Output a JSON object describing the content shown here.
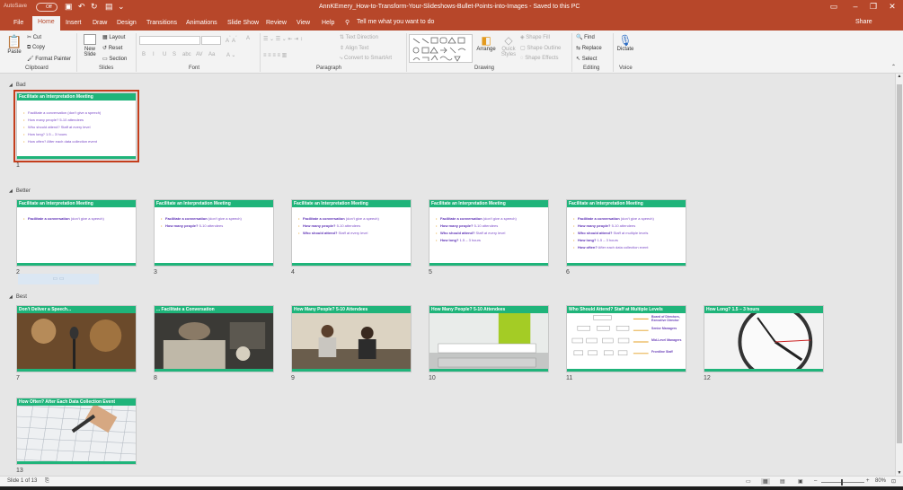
{
  "titlebar": {
    "autosave_label": "AutoSave",
    "autosave_state": "Off",
    "document_title": "AnnKEmery_How-to-Transform-Your-Slideshows-Bullet-Points-into-Images  -  Saved to this PC"
  },
  "tabs": [
    "File",
    "Home",
    "Insert",
    "Draw",
    "Design",
    "Transitions",
    "Animations",
    "Slide Show",
    "Review",
    "View",
    "Help"
  ],
  "active_tab": "Home",
  "tell_me": "Tell me what you want to do",
  "share": "Share",
  "ribbon": {
    "clipboard": {
      "paste": "Paste",
      "cut": "Cut",
      "copy": "Copy",
      "format_painter": "Format Painter",
      "label": "Clipboard"
    },
    "slides": {
      "new_slide": "New Slide",
      "layout": "Layout",
      "reset": "Reset",
      "section": "Section",
      "label": "Slides"
    },
    "font": {
      "label": "Font",
      "format_buttons": [
        "B",
        "I",
        "U",
        "S",
        "abc",
        "AV",
        "Aa"
      ]
    },
    "paragraph": {
      "text_direction": "Text Direction",
      "align_text": "Align Text",
      "convert_smartart": "Convert to SmartArt",
      "label": "Paragraph"
    },
    "drawing": {
      "arrange": "Arrange",
      "quick_styles": "Quick Styles",
      "shape_fill": "Shape Fill",
      "shape_outline": "Shape Outline",
      "shape_effects": "Shape Effects",
      "label": "Drawing"
    },
    "editing": {
      "find": "Find",
      "replace": "Replace",
      "select": "Select",
      "label": "Editing"
    },
    "voice": {
      "dictate": "Dictate",
      "label": "Voice"
    }
  },
  "sections": [
    {
      "name": "Bad"
    },
    {
      "name": "Better"
    },
    {
      "name": "Best"
    }
  ],
  "slides": [
    {
      "num": "1",
      "title": "Facilitate an Interpretation Meeting",
      "bullets": [
        [
          "",
          "Facilitate a conversation (don't give a speech)"
        ],
        [
          "",
          "How many people? 5-10 attendees"
        ],
        [
          "",
          "Who should attend? Staff at every level"
        ],
        [
          "",
          "How long? 1.5 – 3 hours"
        ],
        [
          "",
          "How often? After each data collection event"
        ]
      ],
      "kind": "text"
    },
    {
      "num": "2",
      "title": "Facilitate an Interpretation Meeting",
      "bullets": [
        [
          "Facilitate a conversation",
          " (don't give a speech)"
        ]
      ],
      "kind": "text"
    },
    {
      "num": "3",
      "title": "Facilitate an Interpretation Meeting",
      "bullets": [
        [
          "Facilitate a conversation",
          " (don't give a speech)"
        ],
        [
          "How many people?",
          " 5-10 attendees"
        ]
      ],
      "kind": "text"
    },
    {
      "num": "4",
      "title": "Facilitate an Interpretation Meeting",
      "bullets": [
        [
          "Facilitate a conversation",
          " (don't give a speech)"
        ],
        [
          "How many people?",
          " 5-10 attendees"
        ],
        [
          "Who should attend?",
          " Staff at every level"
        ]
      ],
      "kind": "text"
    },
    {
      "num": "5",
      "title": "Facilitate an Interpretation Meeting",
      "bullets": [
        [
          "Facilitate a conversation",
          " (don't give a speech)"
        ],
        [
          "How many people?",
          " 5-10 attendees"
        ],
        [
          "Who should attend?",
          " Staff at every level"
        ],
        [
          "How long?",
          " 1.5 – 3 hours"
        ]
      ],
      "kind": "text"
    },
    {
      "num": "6",
      "title": "Facilitate an Interpretation Meeting",
      "bullets": [
        [
          "Facilitate a conversation",
          " (don't give a speech)"
        ],
        [
          "How many people?",
          " 5-10 attendees"
        ],
        [
          "Who should attend?",
          " Staff at multiple levels"
        ],
        [
          "How long?",
          " 1.5 – 3 hours"
        ],
        [
          "How often?",
          " After each data collection event"
        ]
      ],
      "kind": "text"
    },
    {
      "num": "7",
      "title": "Don't Deliver a Speech...",
      "kind": "photo",
      "photo": "microphone"
    },
    {
      "num": "8",
      "title": "... Facilitate a Conversation",
      "kind": "photo",
      "photo": "meeting"
    },
    {
      "num": "9",
      "title": "How Many People? 5-10 Attendees",
      "kind": "photo",
      "photo": "people"
    },
    {
      "num": "10",
      "title": "How Many People? 5-10 Attendees",
      "kind": "photo",
      "photo": "room"
    },
    {
      "num": "11",
      "title": "Who Should Attend? Staff at Multiple Levels",
      "kind": "diagram",
      "labels": [
        "Board of Directors, Executive Director",
        "Senior Managers",
        "Mid-Level Managers",
        "Frontline Staff"
      ]
    },
    {
      "num": "12",
      "title": "How Long? 1.5 – 3 hours",
      "kind": "photo",
      "photo": "clock"
    },
    {
      "num": "13",
      "title": "How Often? After Each Data Collection Event",
      "kind": "photo",
      "photo": "calendar"
    }
  ],
  "statusbar": {
    "slide_info": "Slide 1 of 13",
    "zoom": "80%"
  },
  "colors": {
    "ribbon_red": "#b7472a",
    "slide_green": "#1fb47a",
    "bullet_purple": "#7a49c7",
    "selection": "#c43e1c"
  }
}
